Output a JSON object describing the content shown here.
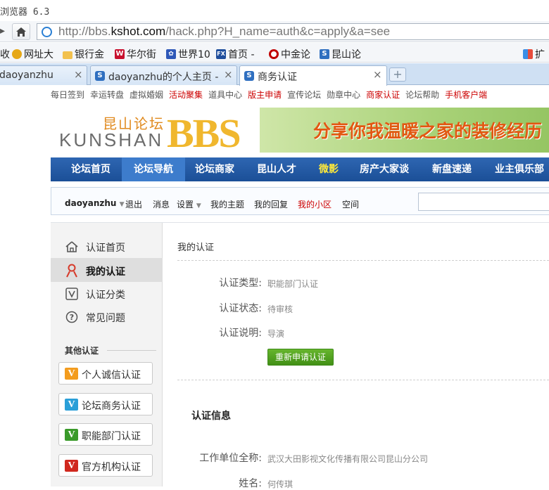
{
  "browser": {
    "title": "浏览器 6.3",
    "url_prefix": "http://bbs.",
    "url_domain": "kshot.com",
    "url_path": "/hack.php?H_name=auth&c=apply&a=see"
  },
  "favorites": [
    {
      "label": "收",
      "icon": "favorite-icon",
      "color": "#999999"
    },
    {
      "label": "网址大",
      "icon": "globe-icon",
      "color": "#e6a817"
    },
    {
      "label": "银行金",
      "icon": "folder-icon",
      "color": "#f2c14e"
    },
    {
      "label": "华尔街",
      "icon": "w-icon",
      "color": "#c8102e"
    },
    {
      "label": "世界10",
      "icon": "paw-icon",
      "color": "#2e58b8"
    },
    {
      "label": "首页 -",
      "icon": "fx-icon",
      "color": "#1f4e9c"
    },
    {
      "label": "中金论",
      "icon": "o-icon",
      "color": "#c00000"
    },
    {
      "label": "昆山论",
      "icon": "s-icon",
      "color": "#2f6fc0"
    },
    {
      "label": "扩",
      "icon": "apps-icon",
      "color": "#3a8ee6"
    }
  ],
  "tabs": [
    {
      "label": "daoyanzhu"
    },
    {
      "label": "daoyanzhu的个人主页 -"
    },
    {
      "label": "商务认证"
    }
  ],
  "toplinks": [
    {
      "label": "每日签到",
      "red": false
    },
    {
      "label": "幸运转盘",
      "red": false
    },
    {
      "label": "虚拟婚姻",
      "red": false
    },
    {
      "label": "活动聚集",
      "red": true
    },
    {
      "label": "道具中心",
      "red": false
    },
    {
      "label": "版主申请",
      "red": true
    },
    {
      "label": "宣传论坛",
      "red": false
    },
    {
      "label": "勋章中心",
      "red": false
    },
    {
      "label": "商家认证",
      "red": true
    },
    {
      "label": "论坛帮助",
      "red": false
    },
    {
      "label": "手机客户端",
      "red": true
    }
  ],
  "logo": {
    "cn": "昆山论坛",
    "en": "KUNSHAN",
    "bbs": "BBS"
  },
  "banner": {
    "text": "分享你我温暖之家的装修经历"
  },
  "mainnav": [
    {
      "label": "论坛首页"
    },
    {
      "label": "论坛导航"
    },
    {
      "label": "论坛商家"
    },
    {
      "label": "昆山人才"
    },
    {
      "label": "微影"
    },
    {
      "label": "房产大家谈"
    },
    {
      "label": "新盘速递"
    },
    {
      "label": "业主俱乐部"
    }
  ],
  "userbar": {
    "username": "daoyanzhu",
    "logout": "退出",
    "messages": "消息",
    "settings": "设置",
    "my_topics": "我的主题",
    "my_replies": "我的回复",
    "my_area": "我的小区",
    "space": "空间"
  },
  "sidebar": {
    "items": [
      {
        "label": "认证首页",
        "icon": "home-icon"
      },
      {
        "label": "我的认证",
        "icon": "user-icon"
      },
      {
        "label": "认证分类",
        "icon": "v-icon"
      },
      {
        "label": "常见问题",
        "icon": "question-icon"
      }
    ],
    "other_title": "其他认证",
    "other": [
      {
        "label": "个人诚信认证",
        "color": "#f39c1e"
      },
      {
        "label": "论坛商务认证",
        "color": "#2a9fd8"
      },
      {
        "label": "职能部门认证",
        "color": "#3a9a2a"
      },
      {
        "label": "官方机构认证",
        "color": "#d0281e"
      }
    ]
  },
  "main": {
    "heading": "我的认证",
    "type_label": "认证类型:",
    "type_value": "职能部门认证",
    "status_label": "认证状态:",
    "status_value": "待审核",
    "desc_label": "认证说明:",
    "desc_value": "导演",
    "reapply": "重新申请认证",
    "info_title": "认证信息",
    "company_label": "工作单位全称:",
    "company_value": "武汉大田影视文化传播有限公司昆山分公司",
    "name_label": "姓名:",
    "name_value": "何传琪"
  }
}
